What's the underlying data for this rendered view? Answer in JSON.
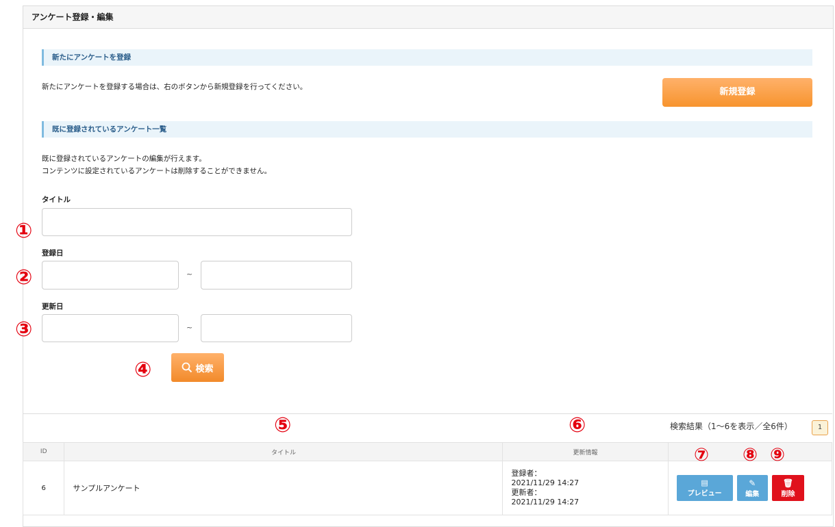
{
  "panel": {
    "title": "アンケート登録・編集"
  },
  "new_section": {
    "heading": "新たにアンケートを登録",
    "description": "新たにアンケートを登録する場合は、右のボタンから新規登録を行ってください。",
    "button_label": "新規登録"
  },
  "list_section": {
    "heading": "既に登録されているアンケート一覧",
    "description_1": "既に登録されているアンケートの編集が行えます。",
    "description_2": "コンテンツに設定されているアンケートは削除することができません。"
  },
  "search_form": {
    "title_label": "タイトル",
    "reg_date_label": "登録日",
    "upd_date_label": "更新日",
    "range_sep": "~",
    "search_button": "検索"
  },
  "annotations": [
    "①",
    "②",
    "③",
    "④",
    "⑤",
    "⑥",
    "⑦",
    "⑧",
    "⑨"
  ],
  "results": {
    "summary": "検索結果（1〜6を表示／全6件）",
    "page": "1"
  },
  "table": {
    "headers": {
      "id": "ID",
      "title": "タイトル",
      "update_info": "更新情報"
    },
    "rows": [
      {
        "id": "6",
        "title": "サンプルアンケート",
        "registrant_label": "登録者：",
        "registered_at": "2021/11/29 14:27",
        "updater_label": "更新者：",
        "updated_at": "2021/11/29 14:27"
      }
    ],
    "actions": {
      "preview": "プレビュー",
      "edit": "編集",
      "delete": "削除"
    }
  },
  "colors": {
    "accent_orange": "#f7942e",
    "preview_blue": "#5aa7d8",
    "delete_red": "#e0111c",
    "annotation_red": "#e4000f"
  }
}
